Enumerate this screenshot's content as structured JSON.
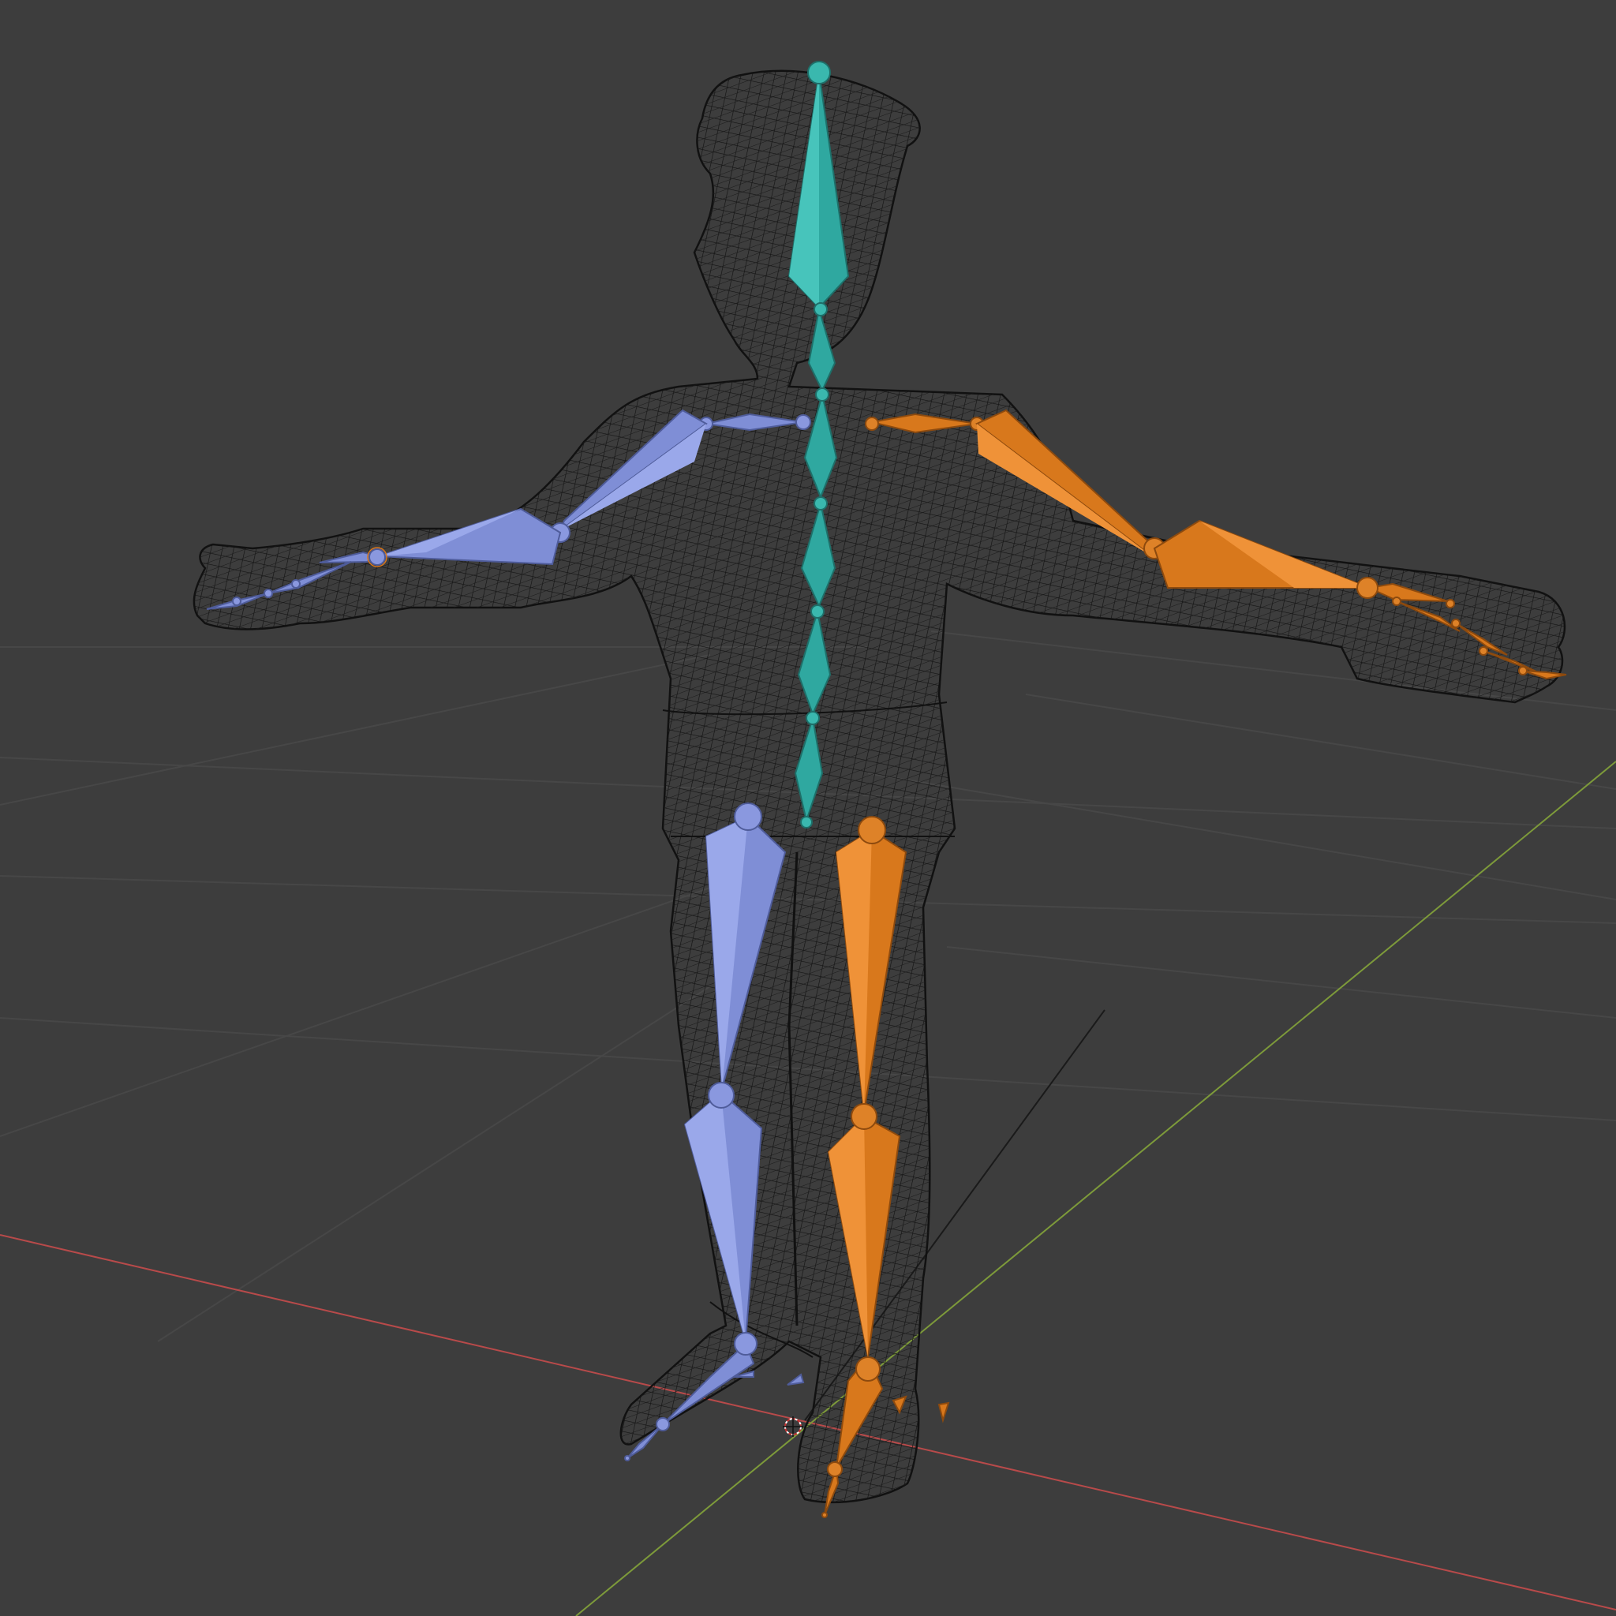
{
  "viewport": {
    "background_color": "#3d3d3d",
    "grid_color": "#4a4a4a",
    "x_axis_color": "#b84a4a",
    "y_axis_color": "#7d9a3a"
  },
  "armature": {
    "spine_color": "#2fa8a0",
    "left_side_color": "#7f8ed6",
    "right_side_color": "#d8781c"
  },
  "mesh": {
    "wire_color": "#111111"
  }
}
